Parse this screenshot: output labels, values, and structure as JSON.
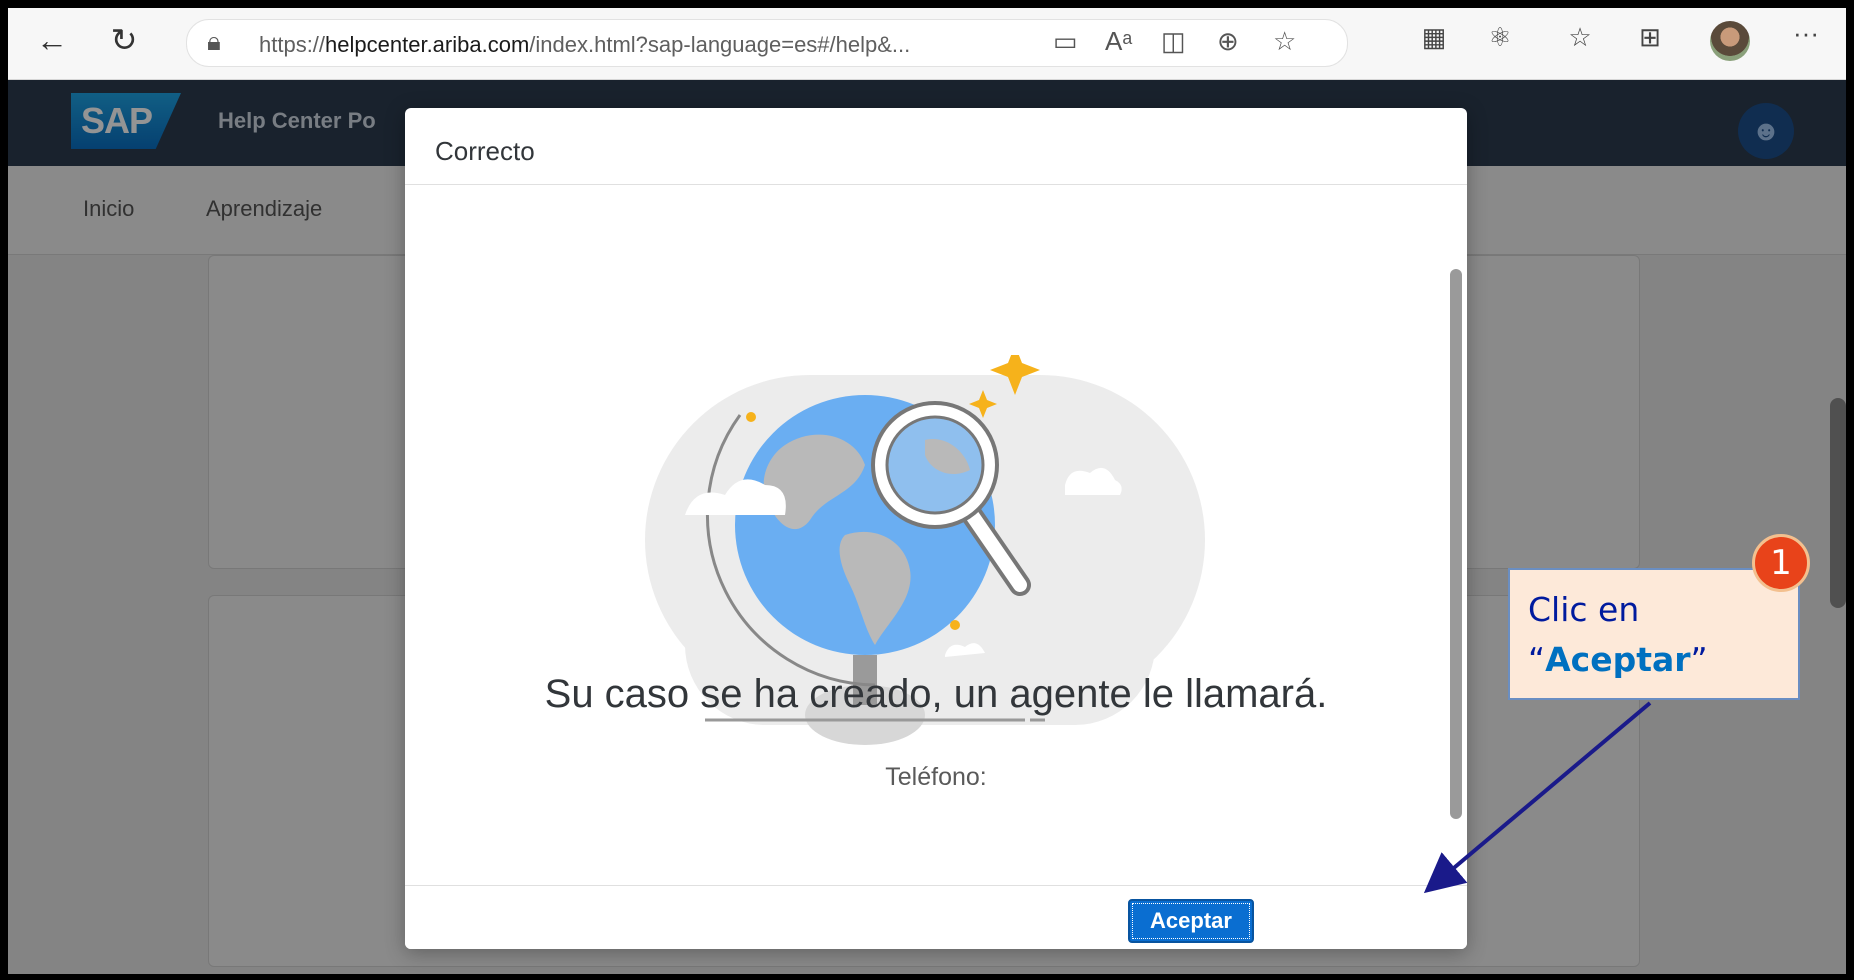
{
  "browser": {
    "url_prefix": "https://",
    "url_host": "helpcenter.ariba.com",
    "url_rest": "/index.html?sap-language=es#/help&...",
    "icons": [
      "back-icon",
      "refresh-icon",
      "lock-icon",
      "share-icon",
      "read-aloud-icon",
      "immersive-reader-icon",
      "zoom-icon",
      "favorite-icon",
      "extension-icon",
      "puzzle-icon",
      "favorites-list-icon",
      "collections-icon",
      "profile-icon",
      "more-icon"
    ],
    "more_label": "···"
  },
  "header": {
    "logo_text": "SAP",
    "title": "Help Center Po"
  },
  "sub_nav": {
    "items": [
      "Inicio",
      "Aprendizaje"
    ]
  },
  "dialog": {
    "title": "Correcto",
    "message": "Su caso se ha creado, un agente le llamará.",
    "phone_label": "Teléfono:",
    "accept_label": "Aceptar"
  },
  "callout": {
    "step_number": "1",
    "line1": "Clic en",
    "quote_open": "“",
    "emphasis": "Aceptar",
    "quote_close": "”"
  },
  "colors": {
    "header_bg": "#2b3b4e",
    "button_blue": "#0a6ed1",
    "callout_bg": "#fde9d9",
    "callout_text": "#001a9e",
    "badge": "#e8431a",
    "globe_blue": "#6aaef2",
    "sparkle": "#f6b21b"
  }
}
